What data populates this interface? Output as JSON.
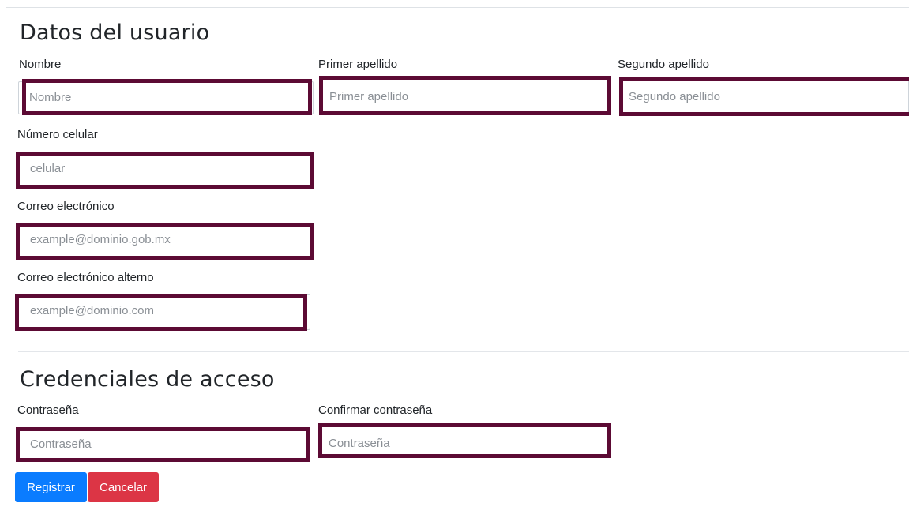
{
  "sections": {
    "user_data_title": "Datos del usuario",
    "credentials_title": "Credenciales de acceso"
  },
  "fields": {
    "nombre": {
      "label": "Nombre",
      "placeholder": "Nombre"
    },
    "primer_apellido": {
      "label": "Primer apellido",
      "placeholder": "Primer apellido"
    },
    "segundo_apellido": {
      "label": "Segundo apellido",
      "placeholder": "Segundo apellido"
    },
    "celular": {
      "label": "Número celular",
      "placeholder": "celular"
    },
    "correo": {
      "label": "Correo electrónico",
      "placeholder": "example@dominio.gob.mx"
    },
    "correo_alterno": {
      "label": "Correo electrónico alterno",
      "placeholder": "example@dominio.com"
    },
    "contrasena": {
      "label": "Contraseña",
      "placeholder": "Contraseña"
    },
    "confirmar": {
      "label": "Confirmar contraseña",
      "placeholder": "Contraseña"
    }
  },
  "buttons": {
    "register": "Registrar",
    "cancel": "Cancelar"
  },
  "colors": {
    "highlight_border": "#5c0a34",
    "primary_button": "#0a7cff",
    "danger_button": "#dc3545"
  }
}
